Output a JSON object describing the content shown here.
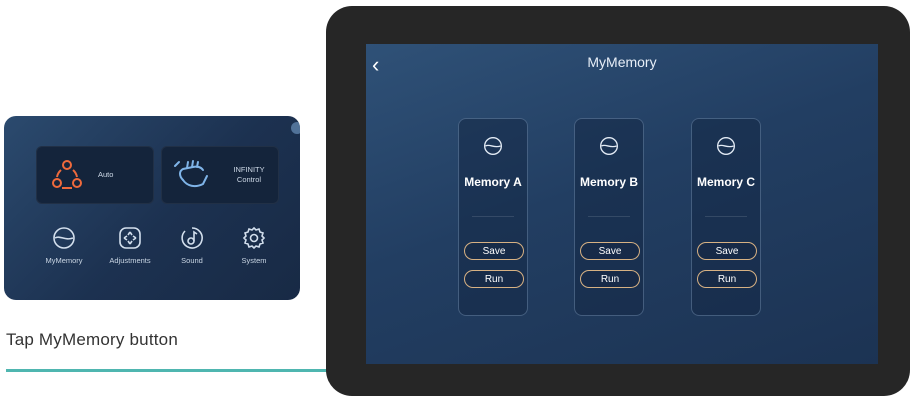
{
  "mini_panel": {
    "cards": [
      {
        "label": "Auto",
        "icon": "recline-cycle-icon"
      },
      {
        "label": "INFINITY Control",
        "icon": "hand-gesture-icon"
      }
    ],
    "icons": [
      {
        "label": "MyMemory",
        "icon": "memory-wave-icon"
      },
      {
        "label": "Adjustments",
        "icon": "adjustments-icon"
      },
      {
        "label": "Sound",
        "icon": "sound-icon"
      },
      {
        "label": "System",
        "icon": "gear-icon"
      }
    ]
  },
  "caption": "Tap MyMemory button",
  "screen": {
    "title": "MyMemory",
    "back_icon": "‹",
    "memories": [
      {
        "name": "Memory A",
        "save_label": "Save",
        "run_label": "Run"
      },
      {
        "name": "Memory B",
        "save_label": "Save",
        "run_label": "Run"
      },
      {
        "name": "Memory C",
        "save_label": "Save",
        "run_label": "Run"
      }
    ]
  },
  "colors": {
    "accent_orange": "#ef6a3c",
    "accent_blue": "#7fb4e8",
    "button_border": "#d7b183",
    "arrow": "#4fb6b0"
  }
}
